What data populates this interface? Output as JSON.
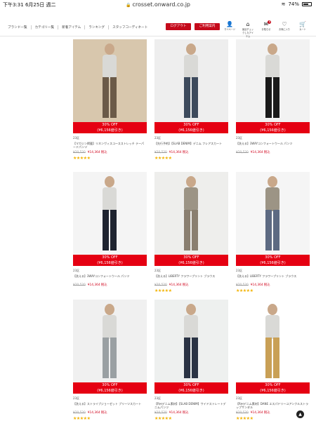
{
  "status": {
    "time": "下午3:31  6月25日 週二",
    "url": "crosset.onward.co.jp",
    "battery": "74%",
    "battery_level": 0.74
  },
  "nav": {
    "items": [
      "ブランド一覧",
      "カテゴリ一覧",
      "新着アイテム",
      "ランキング",
      "スタッフコーディネート"
    ]
  },
  "header": {
    "logout": "ログアウト",
    "purchase": "ご利用案内"
  },
  "icons": [
    {
      "icon": "user-icon",
      "glyph": "👤",
      "label": "マイページ",
      "badge": ""
    },
    {
      "icon": "recent-icon",
      "glyph": "⌂",
      "label": "最近チェックしたアイテム",
      "badge": ""
    },
    {
      "icon": "mail-icon",
      "glyph": "✉",
      "label": "お知らせ",
      "badge": "8"
    },
    {
      "icon": "heart-icon",
      "glyph": "♡",
      "label": "お気に入り",
      "badge": ""
    },
    {
      "icon": "cart-icon",
      "glyph": "🛒",
      "label": "カート",
      "badge": ""
    }
  ],
  "products": [
    {
      "discount": "30% OFF",
      "off": "(¥6,156値引き)",
      "size": "23区",
      "name": "【マガジン掲載】リネンヴィスコースストレッチ テーパードパンツ",
      "old": "¥20,520",
      "new": "¥14,364",
      "tax": "税込",
      "rating": 4.5,
      "bg": "#d8c7ad",
      "fig": "#6b5a48"
    },
    {
      "discount": "30% OFF",
      "off": "(¥6,156値引き)",
      "size": "23区",
      "name": "【先行予約】【SLAB DENIM】デニム フレアスカート",
      "old": "¥20,520",
      "new": "¥14,364",
      "tax": "税込",
      "rating": 5,
      "bg": "#eeeeee",
      "fig": "#3d4a5c"
    },
    {
      "discount": "30% OFF",
      "off": "(¥6,156値引き)",
      "size": "23区",
      "name": "【洗える】3WAYコンフォートウール パンツ",
      "old": "¥20,520",
      "new": "¥14,364",
      "tax": "税込",
      "rating": 0,
      "bg": "#f2f2f2",
      "fig": "#1a1a1a"
    },
    {
      "discount": "30% OFF",
      "off": "(¥6,156値引き)",
      "size": "23区",
      "name": "【洗える】3WAYコンフォートウール パンツ",
      "old": "¥20,520",
      "new": "¥14,364",
      "tax": "税込",
      "rating": 0,
      "bg": "#f4f4f4",
      "fig": "#1f2430"
    },
    {
      "discount": "30% OFF",
      "off": "(¥6,156値引き)",
      "size": "23区",
      "name": "【洗える】LIBERTY フラワープリント ブラウス",
      "old": "¥20,520",
      "new": "¥14,364",
      "tax": "税込",
      "rating": 4.5,
      "bg": "#eeeeec",
      "fig": "#8a7f70"
    },
    {
      "discount": "30% OFF",
      "off": "(¥6,156値引き)",
      "size": "23区",
      "name": "【洗える】LIBERTY フラワープリント ブラウス",
      "old": "¥20,520",
      "new": "¥14,364",
      "tax": "税込",
      "rating": 4.5,
      "bg": "#f5f5f5",
      "fig": "#5d6a82"
    },
    {
      "discount": "30% OFF",
      "off": "(¥6,156値引き)",
      "size": "23区",
      "name": "【洗える】ストライプジョーゼット プリーツスカート",
      "old": "¥20,520",
      "new": "¥14,364",
      "tax": "税込",
      "rating": 5,
      "bg": "#f0f0f0",
      "fig": "#9aa0a3"
    },
    {
      "discount": "30% OFF",
      "off": "(¥6,156値引き)",
      "size": "23区",
      "name": "【R州デニム素材】【SLAB DENIM】ワイドストレートデニムパンツ",
      "old": "¥20,520",
      "new": "¥14,364",
      "tax": "税込",
      "rating": 5,
      "bg": "#eef0ef",
      "fig": "#2a3344"
    },
    {
      "discount": "30% OFF",
      "off": "(¥6,156値引き)",
      "size": "23区",
      "name": "【R州デニム素材】DANE エスパドリーユアンクルストラップサンダル",
      "old": "¥20,520",
      "new": "¥14,364",
      "tax": "税込",
      "rating": 5,
      "bg": "#ffffff",
      "fig": "#c9a056"
    }
  ],
  "colors": {
    "accent": "#e50012",
    "brand": "#c50a1b",
    "star": "#f2b200"
  }
}
